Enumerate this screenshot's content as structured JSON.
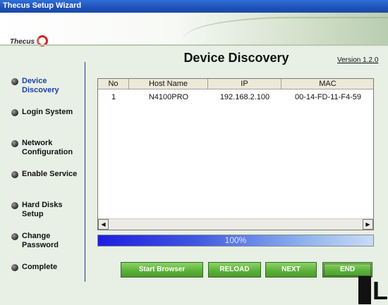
{
  "window": {
    "title": "Thecus Setup Wizard"
  },
  "brand": {
    "logo_text": "Thecus"
  },
  "sidebar": {
    "items": [
      {
        "label": "Device Discovery",
        "active": true
      },
      {
        "label": "Login System",
        "active": false
      },
      {
        "label": "Network Configuration",
        "active": false
      },
      {
        "label": "Enable Service",
        "active": false
      },
      {
        "label": "Hard Disks Setup",
        "active": false
      },
      {
        "label": "Change Password",
        "active": false
      },
      {
        "label": "Complete",
        "active": false
      }
    ]
  },
  "main": {
    "heading": "Device Discovery",
    "version": "Version 1.2.0",
    "table": {
      "columns": [
        "No",
        "Host Name",
        "IP",
        "MAC"
      ],
      "rows": [
        [
          "1",
          "N4100PRO",
          "192.168.2.100",
          "00-14-FD-11-F4-59"
        ]
      ]
    },
    "progress": {
      "value": 1.0,
      "label": "100%"
    }
  },
  "buttons": {
    "start_browser": "Start Browser",
    "reload": "RELOAD",
    "next": "NEXT",
    "end": "END"
  },
  "colors": {
    "title_bar": "#1e52b8",
    "button_green": "#5db23a",
    "active_step": "#1b3faa",
    "progress_blue": "#1d1ee0"
  },
  "icons": {
    "step_bullet": "dark-round-bullet-icon",
    "scroll_left": "arrow-left-icon",
    "scroll_right": "arrow-right-icon"
  }
}
